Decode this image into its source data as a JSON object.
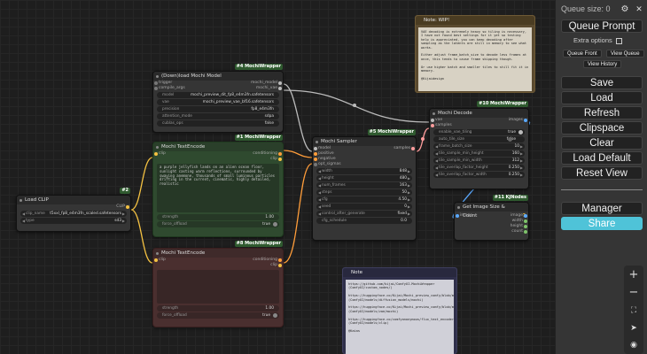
{
  "panel": {
    "queue_size": "Queue size: 0",
    "queue_prompt": "Queue Prompt",
    "extra_options": "Extra options",
    "queue_front": "Queue Front",
    "view_queue": "View Queue",
    "view_history": "View History",
    "save": "Save",
    "load": "Load",
    "refresh": "Refresh",
    "clipspace": "Clipspace",
    "clear": "Clear",
    "load_default": "Load Default",
    "reset_view": "Reset View",
    "manager": "Manager",
    "share": "Share",
    "share_color": "#4fc3d8"
  },
  "zoom": {
    "plus": "+",
    "minus": "−"
  },
  "nodes": {
    "load_clip": {
      "title": "Load CLIP",
      "badge": "#2",
      "out": "CLIP",
      "clip_name_label": "clip_name",
      "clip_name_value": "t5xxl_fp8_e4m3fn_scaled.safetensors",
      "type_label": "type",
      "type_value": "sd3"
    },
    "download_model": {
      "title": "(Down)load Mochi Model",
      "badge": "#4 MochiWrapper",
      "in1": "trigger",
      "in2": "compile_args",
      "out1": "mochi_model",
      "out2": "mochi_vae",
      "w": [
        {
          "l": "model",
          "v": "mochi_preview_dit_fp8_e4m3fn.safetensors"
        },
        {
          "l": "vae",
          "v": "mochi_preview_vae_bf16.safetensors"
        },
        {
          "l": "precision",
          "v": "fp8_e4m3fn"
        },
        {
          "l": "attention_mode",
          "v": "sdpa"
        },
        {
          "l": "cublas_ops",
          "v": "false"
        }
      ]
    },
    "text_pos": {
      "title": "Mochi TextEncode",
      "badge": "#1 MochiWrapper",
      "in": "clip",
      "out1": "conditioning",
      "out2": "clip",
      "text": "a purple jellyfish lands on an alien ocean floor, sunlight casting warm reflections, surrounded by swaying anemone, thousands of small luminous particles drifting in the current, cinematic, highly detailed, realistic",
      "strength_label": "strength",
      "strength_value": "1.00",
      "force_offload_label": "force_offload",
      "force_offload_value": "true"
    },
    "text_neg": {
      "title": "Mochi TextEncode",
      "badge": "#8 MochiWrapper",
      "in": "clip",
      "out1": "conditioning",
      "out2": "clip",
      "text": "",
      "strength_label": "strength",
      "strength_value": "1.00",
      "force_offload_label": "force_offload",
      "force_offload_value": "true"
    },
    "sampler": {
      "title": "Mochi Sampler",
      "badge": "#5 MochiWrapper",
      "in": [
        "model",
        "positive",
        "negative",
        "opt_sigmas"
      ],
      "out": "samples",
      "w": [
        {
          "l": "width",
          "v": "848"
        },
        {
          "l": "height",
          "v": "480"
        },
        {
          "l": "num_frames",
          "v": "163"
        },
        {
          "l": "steps",
          "v": "50"
        },
        {
          "l": "cfg",
          "v": "4.50"
        },
        {
          "l": "seed",
          "v": "0"
        },
        {
          "l": "control_after_generate",
          "v": "fixed"
        },
        {
          "l": "cfg_schedule",
          "v": "0.0"
        }
      ]
    },
    "decode": {
      "title": "Mochi Decode",
      "badge": "#10 MochiWrapper",
      "in1": "vae",
      "in2": "samples",
      "out": "images",
      "w": [
        {
          "l": "enable_vae_tiling",
          "v": "true"
        },
        {
          "l": "auto_tile_size",
          "v": "false"
        },
        {
          "l": "frame_batch_size",
          "v": "10"
        },
        {
          "l": "tile_sample_min_height",
          "v": "160"
        },
        {
          "l": "tile_sample_min_width",
          "v": "312"
        },
        {
          "l": "tile_overlap_factor_height",
          "v": "0.250"
        },
        {
          "l": "tile_overlap_factor_width",
          "v": "0.250"
        }
      ]
    },
    "get_image": {
      "title": "Get Image Size & Count",
      "badge": "#11 KJNodes",
      "in": "image",
      "outs": [
        "image",
        "width",
        "height",
        "count"
      ]
    }
  },
  "notes": {
    "wip": {
      "title": "Note: WIP!",
      "body": "VAE decoding is extremely heavy so tiling is necessary, I have not found best settings for it yet so testing help is appreciated, you can keep decoding after sampling as the latents are still in memory to see what works.\n\nEither adjust frame_batch_size to decode less frames at once, this tends to cause frame skipping though.\n\nOr use higher batch and smaller tiles to still fit it in memory.\n\n@Kijaidesign"
    },
    "note": {
      "title": "Note",
      "body": "https://github.com/kijai/ComfyUI-MochiWrapper\n(ComfyUI/custom_nodes/)\n\nhttps://huggingface.co/Kijai/Mochi_preview_comfy/blob/main/mochi_preview_dit_fp8_e4m3fn.safetensors\n(ComfyUI/models/diffusion_models/mochi)\n\nhttps://huggingface.co/Kijai/Mochi_preview_comfy/blob/main/mochi_preview_vae_bf16.safetensors\n(ComfyUI/models/vae/mochi)\n\nhttps://huggingface.co/comfyanonymous/flux_text_encoders/blob/main/t5xxl_fp8_e4m3fn_scaled.safetensors\n(ComfyUI/models/clip)\n\n@Kaias"
    }
  }
}
